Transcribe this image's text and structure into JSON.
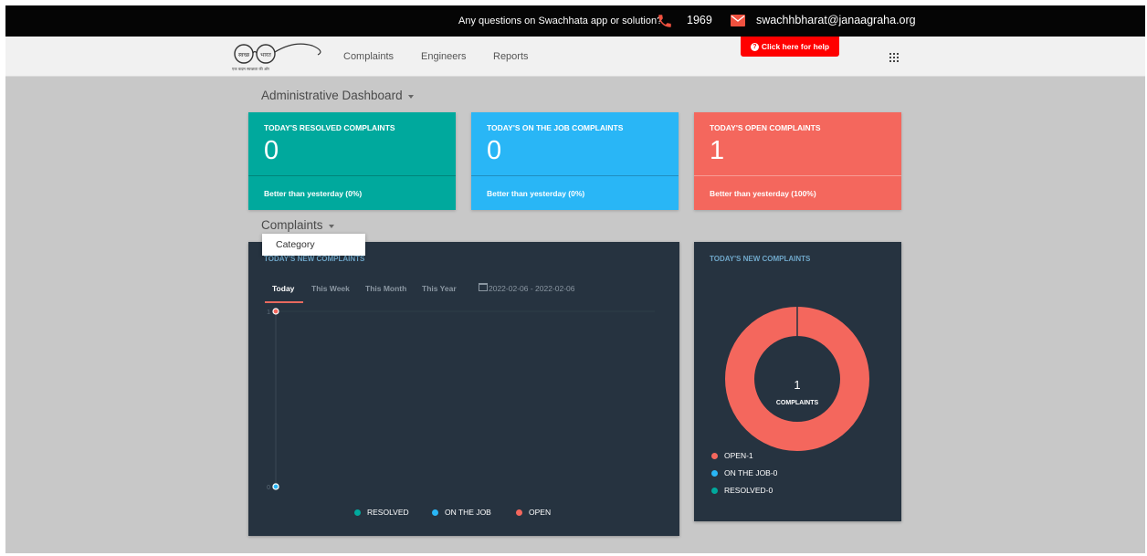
{
  "colors": {
    "accent_red": "#f00",
    "resolved": "#00a99d",
    "on_the_job": "#29b6f6",
    "open": "#f4675d",
    "panel_bg": "#263340"
  },
  "infobar": {
    "question": "Any questions on Swachhata app or solution?",
    "phone": "1969",
    "email": "swachhbharat@janaagraha.org",
    "icons": [
      "phone-icon",
      "mail-icon"
    ]
  },
  "nav": {
    "logo_text": [
      "स्वच्छ",
      "भारत"
    ],
    "logo_tagline": "एक कदम स्वच्छता की ओर",
    "links": [
      "Complaints",
      "Engineers",
      "Reports"
    ],
    "help_label": "Click here for help",
    "icons": [
      "help-icon",
      "apps-grid-icon"
    ]
  },
  "dashboard": {
    "title": "Administrative Dashboard",
    "cards": [
      {
        "title": "TODAY'S RESOLVED COMPLAINTS",
        "value": "0",
        "footer": "Better than yesterday (0%)",
        "color": "#00a99d"
      },
      {
        "title": "TODAY'S ON THE JOB COMPLAINTS",
        "value": "0",
        "footer": "Better than yesterday (0%)",
        "color": "#29b6f6"
      },
      {
        "title": "TODAY'S OPEN COMPLAINTS",
        "value": "1",
        "footer": "Better than yesterday (100%)",
        "color": "#f4675d"
      }
    ]
  },
  "complaints": {
    "title": "Complaints",
    "dropdown_item": "Category"
  },
  "line_panel": {
    "title": "TODAY'S NEW COMPLAINTS",
    "tabs": [
      "Today",
      "This Week",
      "This Month",
      "This Year"
    ],
    "active_tab": "Today",
    "date_range": "2022-02-06 - 2022-02-06",
    "y_ticks": [
      "1",
      "0"
    ],
    "legend": [
      "RESOLVED",
      "ON THE JOB",
      "OPEN"
    ]
  },
  "donut_panel": {
    "title": "TODAY'S NEW COMPLAINTS",
    "center_value": "1",
    "center_label": "COMPLAINTS",
    "legend": [
      "OPEN-1",
      "ON THE JOB-0",
      "RESOLVED-0"
    ]
  },
  "chart_data": [
    {
      "type": "line",
      "title": "TODAY'S NEW COMPLAINTS",
      "ylim": [
        0,
        1
      ],
      "grid": false,
      "legend_position": "bottom",
      "series": [
        {
          "name": "RESOLVED",
          "values": [
            0
          ],
          "color": "#00a99d"
        },
        {
          "name": "ON THE JOB",
          "values": [
            0
          ],
          "color": "#29b6f6"
        },
        {
          "name": "OPEN",
          "values": [
            1
          ],
          "color": "#f4675d"
        }
      ]
    },
    {
      "type": "pie",
      "title": "TODAY'S NEW COMPLAINTS",
      "legend_position": "bottom-left",
      "slices": [
        {
          "label": "OPEN",
          "value": 1,
          "color": "#f4675d"
        },
        {
          "label": "ON THE JOB",
          "value": 0,
          "color": "#29b6f6"
        },
        {
          "label": "RESOLVED",
          "value": 0,
          "color": "#00a99d"
        }
      ]
    }
  ]
}
